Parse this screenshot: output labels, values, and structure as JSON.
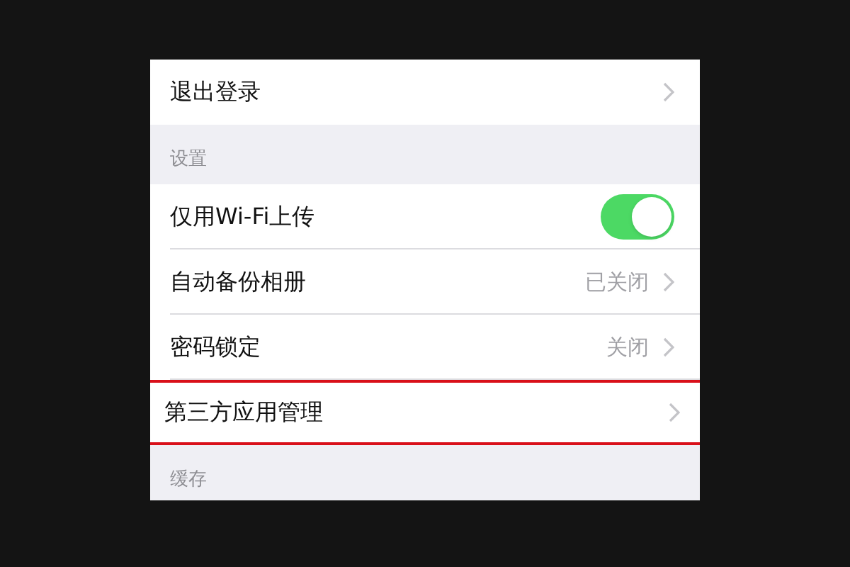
{
  "items": [
    {
      "kind": "link",
      "label": "退出登录",
      "highlighted": false
    },
    {
      "kind": "header",
      "label": "设置"
    },
    {
      "kind": "toggle",
      "label": "仅用Wi-Fi上传",
      "on": true
    },
    {
      "kind": "link",
      "label": "自动备份相册",
      "value": "已关闭",
      "highlighted": false
    },
    {
      "kind": "link",
      "label": "密码锁定",
      "value": "关闭",
      "highlighted": false
    },
    {
      "kind": "link",
      "label": "第三方应用管理",
      "highlighted": true
    },
    {
      "kind": "header",
      "label": "缓存"
    }
  ]
}
